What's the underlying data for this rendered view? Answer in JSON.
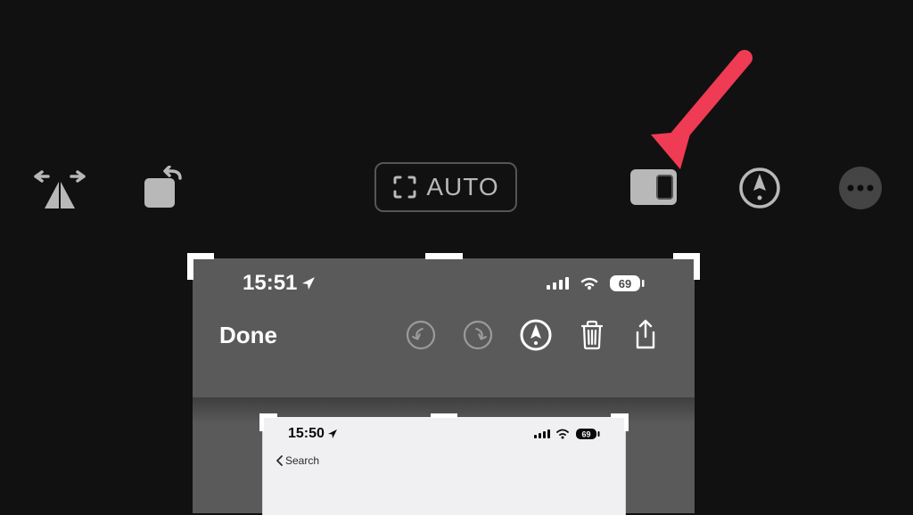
{
  "toolbar": {
    "flip_label": "flip",
    "rotate_label": "rotate",
    "auto_label": "AUTO",
    "aspect_label": "aspect",
    "markup_label": "markup",
    "more_label": "more"
  },
  "preview": {
    "status": {
      "time": "15:51",
      "battery": "69"
    },
    "markup_bar": {
      "done_label": "Done"
    },
    "inner": {
      "time": "15:50",
      "battery": "69",
      "back_label": "Search"
    }
  }
}
